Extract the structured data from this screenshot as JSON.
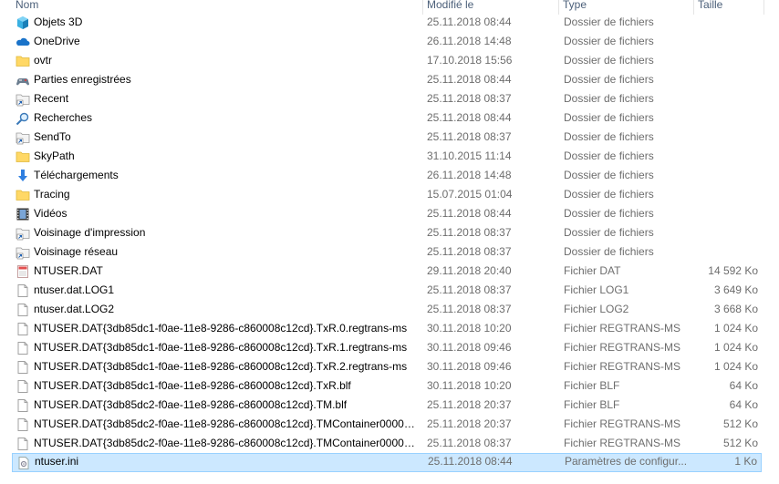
{
  "columns": {
    "name": "Nom",
    "modified": "Modifié le",
    "type": "Type",
    "size": "Taille"
  },
  "rows": [
    {
      "name": "Objets 3D",
      "modified": "25.11.2018 08:44",
      "type": "Dossier de fichiers",
      "size": "",
      "icon": "objects-3d-icon"
    },
    {
      "name": "OneDrive",
      "modified": "26.11.2018 14:48",
      "type": "Dossier de fichiers",
      "size": "",
      "icon": "onedrive-icon"
    },
    {
      "name": "ovtr",
      "modified": "17.10.2018 15:56",
      "type": "Dossier de fichiers",
      "size": "",
      "icon": "folder-icon"
    },
    {
      "name": "Parties enregistrées",
      "modified": "25.11.2018 08:44",
      "type": "Dossier de fichiers",
      "size": "",
      "icon": "saved-games-icon"
    },
    {
      "name": "Recent",
      "modified": "25.11.2018 08:37",
      "type": "Dossier de fichiers",
      "size": "",
      "icon": "shortcut-folder-icon"
    },
    {
      "name": "Recherches",
      "modified": "25.11.2018 08:44",
      "type": "Dossier de fichiers",
      "size": "",
      "icon": "searches-icon"
    },
    {
      "name": "SendTo",
      "modified": "25.11.2018 08:37",
      "type": "Dossier de fichiers",
      "size": "",
      "icon": "shortcut-folder-icon"
    },
    {
      "name": "SkyPath",
      "modified": "31.10.2015 11:14",
      "type": "Dossier de fichiers",
      "size": "",
      "icon": "folder-icon"
    },
    {
      "name": "Téléchargements",
      "modified": "26.11.2018 14:48",
      "type": "Dossier de fichiers",
      "size": "",
      "icon": "downloads-icon"
    },
    {
      "name": "Tracing",
      "modified": "15.07.2015 01:04",
      "type": "Dossier de fichiers",
      "size": "",
      "icon": "folder-icon"
    },
    {
      "name": "Vidéos",
      "modified": "25.11.2018 08:44",
      "type": "Dossier de fichiers",
      "size": "",
      "icon": "videos-icon"
    },
    {
      "name": "Voisinage d'impression",
      "modified": "25.11.2018 08:37",
      "type": "Dossier de fichiers",
      "size": "",
      "icon": "shortcut-folder-icon"
    },
    {
      "name": "Voisinage réseau",
      "modified": "25.11.2018 08:37",
      "type": "Dossier de fichiers",
      "size": "",
      "icon": "shortcut-folder-icon"
    },
    {
      "name": "NTUSER.DAT",
      "modified": "29.11.2018 20:40",
      "type": "Fichier DAT",
      "size": "14 592 Ko",
      "icon": "dat-file-icon"
    },
    {
      "name": "ntuser.dat.LOG1",
      "modified": "25.11.2018 08:37",
      "type": "Fichier LOG1",
      "size": "3 649 Ko",
      "icon": "file-icon"
    },
    {
      "name": "ntuser.dat.LOG2",
      "modified": "25.11.2018 08:37",
      "type": "Fichier LOG2",
      "size": "3 668 Ko",
      "icon": "file-icon"
    },
    {
      "name": "NTUSER.DAT{3db85dc1-f0ae-11e8-9286-c860008c12cd}.TxR.0.regtrans-ms",
      "modified": "30.11.2018 10:20",
      "type": "Fichier REGTRANS-MS",
      "size": "1 024 Ko",
      "icon": "file-icon"
    },
    {
      "name": "NTUSER.DAT{3db85dc1-f0ae-11e8-9286-c860008c12cd}.TxR.1.regtrans-ms",
      "modified": "30.11.2018 09:46",
      "type": "Fichier REGTRANS-MS",
      "size": "1 024 Ko",
      "icon": "file-icon"
    },
    {
      "name": "NTUSER.DAT{3db85dc1-f0ae-11e8-9286-c860008c12cd}.TxR.2.regtrans-ms",
      "modified": "30.11.2018 09:46",
      "type": "Fichier REGTRANS-MS",
      "size": "1 024 Ko",
      "icon": "file-icon"
    },
    {
      "name": "NTUSER.DAT{3db85dc1-f0ae-11e8-9286-c860008c12cd}.TxR.blf",
      "modified": "30.11.2018 10:20",
      "type": "Fichier BLF",
      "size": "64 Ko",
      "icon": "file-icon"
    },
    {
      "name": "NTUSER.DAT{3db85dc2-f0ae-11e8-9286-c860008c12cd}.TM.blf",
      "modified": "25.11.2018 20:37",
      "type": "Fichier BLF",
      "size": "64 Ko",
      "icon": "file-icon"
    },
    {
      "name": "NTUSER.DAT{3db85dc2-f0ae-11e8-9286-c860008c12cd}.TMContainer0000000...",
      "modified": "25.11.2018 20:37",
      "type": "Fichier REGTRANS-MS",
      "size": "512 Ko",
      "icon": "file-icon"
    },
    {
      "name": "NTUSER.DAT{3db85dc2-f0ae-11e8-9286-c860008c12cd}.TMContainer0000000...",
      "modified": "25.11.2018 08:37",
      "type": "Fichier REGTRANS-MS",
      "size": "512 Ko",
      "icon": "file-icon"
    },
    {
      "name": "ntuser.ini",
      "modified": "25.11.2018 08:44",
      "type": "Paramètres de configur...",
      "size": "1 Ko",
      "icon": "ini-file-icon",
      "selected": true
    }
  ],
  "colors": {
    "header_text": "#4c607a",
    "secondary_text": "#6d6d6d",
    "selection_bg": "#cce8ff",
    "selection_border": "#99d1ff",
    "folder": "#ffd866"
  }
}
